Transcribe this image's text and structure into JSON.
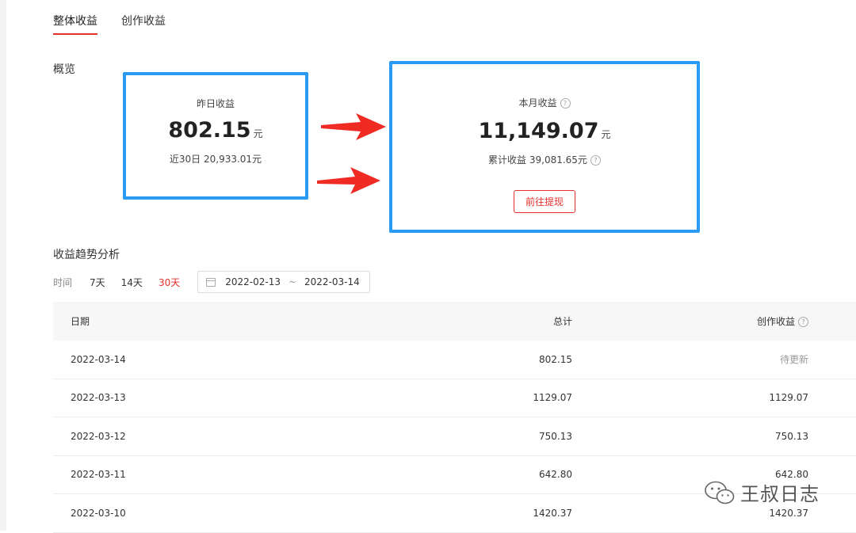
{
  "tabs": [
    {
      "label": "整体收益",
      "active": true
    },
    {
      "label": "创作收益",
      "active": false
    }
  ],
  "overview": {
    "title": "概览",
    "yesterday": {
      "label": "昨日收益",
      "value": "802.15",
      "unit": "元",
      "sub": "近30日 20,933.01元"
    },
    "month": {
      "label": "本月收益",
      "value": "11,149.07",
      "unit": "元",
      "sub": "累计收益 39,081.65元",
      "button": "前往提现"
    }
  },
  "trend": {
    "title": "收益趋势分析",
    "time_label": "时间",
    "ranges": [
      {
        "label": "7天",
        "active": false
      },
      {
        "label": "14天",
        "active": false
      },
      {
        "label": "30天",
        "active": true
      }
    ],
    "date_start": "2022-02-13",
    "date_sep": "~",
    "date_end": "2022-03-14"
  },
  "table": {
    "headers": {
      "date": "日期",
      "total": "总计",
      "create": "创作收益"
    },
    "rows": [
      {
        "date": "2022-03-14",
        "total": "802.15",
        "create": "待更新"
      },
      {
        "date": "2022-03-13",
        "total": "1129.07",
        "create": "1129.07"
      },
      {
        "date": "2022-03-12",
        "total": "750.13",
        "create": "750.13"
      },
      {
        "date": "2022-03-11",
        "total": "642.80",
        "create": "642.80"
      },
      {
        "date": "2022-03-10",
        "total": "1420.37",
        "create": "1420.37"
      }
    ]
  },
  "watermark": {
    "text": "王叔日志",
    "icon": "wechat-icon"
  },
  "colors": {
    "accent": "#e5302b",
    "highlight_border": "#2a9bf4"
  }
}
